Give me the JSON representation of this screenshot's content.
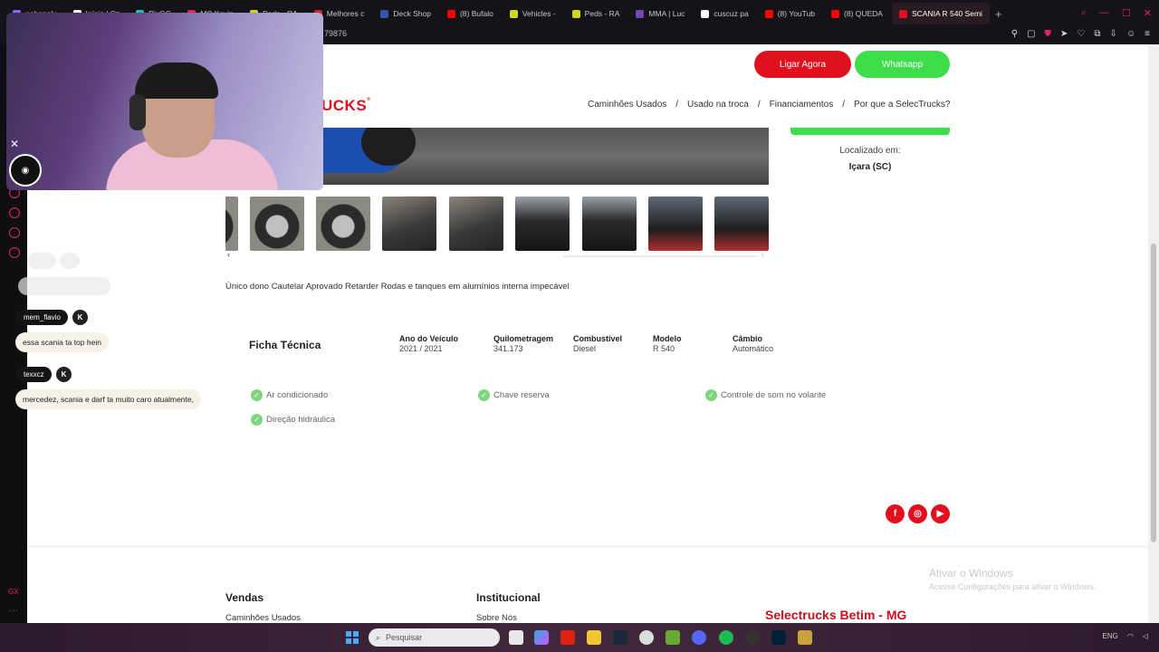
{
  "browser": {
    "tabs": [
      {
        "label": "gabepalx",
        "fav": "#8866ff"
      },
      {
        "label": "Início | Cz",
        "fav": "#ffffff"
      },
      {
        "label": "PixGG",
        "fav": "#19c2a8"
      },
      {
        "label": "MC Kevin",
        "fav": "#e0245e"
      },
      {
        "label": "Peds - RA",
        "fav": "#c8d81a"
      },
      {
        "label": "Melhores c",
        "fav": "#cc2233"
      },
      {
        "label": "Deck Shop",
        "fav": "#3355aa"
      },
      {
        "label": "(8) Bufalo",
        "fav": "#ff0000"
      },
      {
        "label": "Vehicles -",
        "fav": "#c8d81a"
      },
      {
        "label": "Peds - RA",
        "fav": "#c8d81a"
      },
      {
        "label": "MMA | Luc",
        "fav": "#7744bb"
      },
      {
        "label": "cuscuz pa",
        "fav": "#ffffff"
      },
      {
        "label": "(8) YouTub",
        "fav": "#ff0000"
      },
      {
        "label": "(8) QUEDA",
        "fav": "#ff0000"
      },
      {
        "label": "SCANIA R 540 Semi",
        "fav": "#e0101e"
      }
    ],
    "new_tab": "+",
    "url_fragment": "79876",
    "address_icons": [
      "pin-icon",
      "screenshot-icon",
      "shield-icon",
      "send-icon",
      "heart-icon",
      "extensions-icon",
      "download-icon",
      "profile-icon",
      "menu-icon"
    ]
  },
  "site": {
    "call_button": "Ligar Agora",
    "whatsapp_button": "Whatsapp",
    "logo_text": "UCKS",
    "logo_mark": "®",
    "nav": [
      {
        "label": "Caminhões Usados"
      },
      {
        "label": "Usado na troca"
      },
      {
        "label": "Financiamentos"
      },
      {
        "label": "Por que a SelecTrucks?"
      }
    ],
    "nav_separator": "/",
    "location_label": "Localizado em:",
    "location_value": "Içara (SC)",
    "gallery_prev": "‹",
    "gallery_next": "›",
    "description": "Único dono Cautelar Aprovado Retarder Rodas e tanques em alumínios interna impecável",
    "ficha_title": "Ficha Técnica",
    "specs": [
      {
        "key": "Ano do Veículo",
        "value": "2021 / 2021"
      },
      {
        "key": "Quilometragem",
        "value": "341.173"
      },
      {
        "key": "Combustível",
        "value": "Diesel"
      },
      {
        "key": "Modelo",
        "value": "R 540"
      },
      {
        "key": "Câmbio",
        "value": "Automático"
      }
    ],
    "features": [
      "Ar condicionado",
      "Chave reserva",
      "Controle de som no volante",
      "Direção hidráulica"
    ],
    "social": [
      {
        "name": "facebook-icon",
        "glyph": "f"
      },
      {
        "name": "instagram-icon",
        "glyph": "◎"
      },
      {
        "name": "youtube-icon",
        "glyph": "▶"
      }
    ],
    "footer": {
      "vendas_title": "Vendas",
      "vendas_link": "Caminhões Usados",
      "inst_title": "Institucional",
      "inst_link": "Sobre Nós",
      "city": "Selectrucks Betim - MG"
    },
    "brand_color": "#e0101e",
    "whatsapp_color": "#3edd4a"
  },
  "windows_watermark": {
    "title": "Ativar o Windows",
    "subtitle": "Acesse Configurações para ativar o Windows."
  },
  "stream": {
    "chat": [
      {
        "user": "mem_flavio",
        "badge": "K",
        "message": "essa scania ta top hein"
      },
      {
        "user": "texxcz",
        "badge": "K",
        "message": "mercedez, scania e darf ta muito caro atualmente,"
      }
    ]
  },
  "taskbar": {
    "search_placeholder": "Pesquisar",
    "tray_lang": "ENG"
  }
}
